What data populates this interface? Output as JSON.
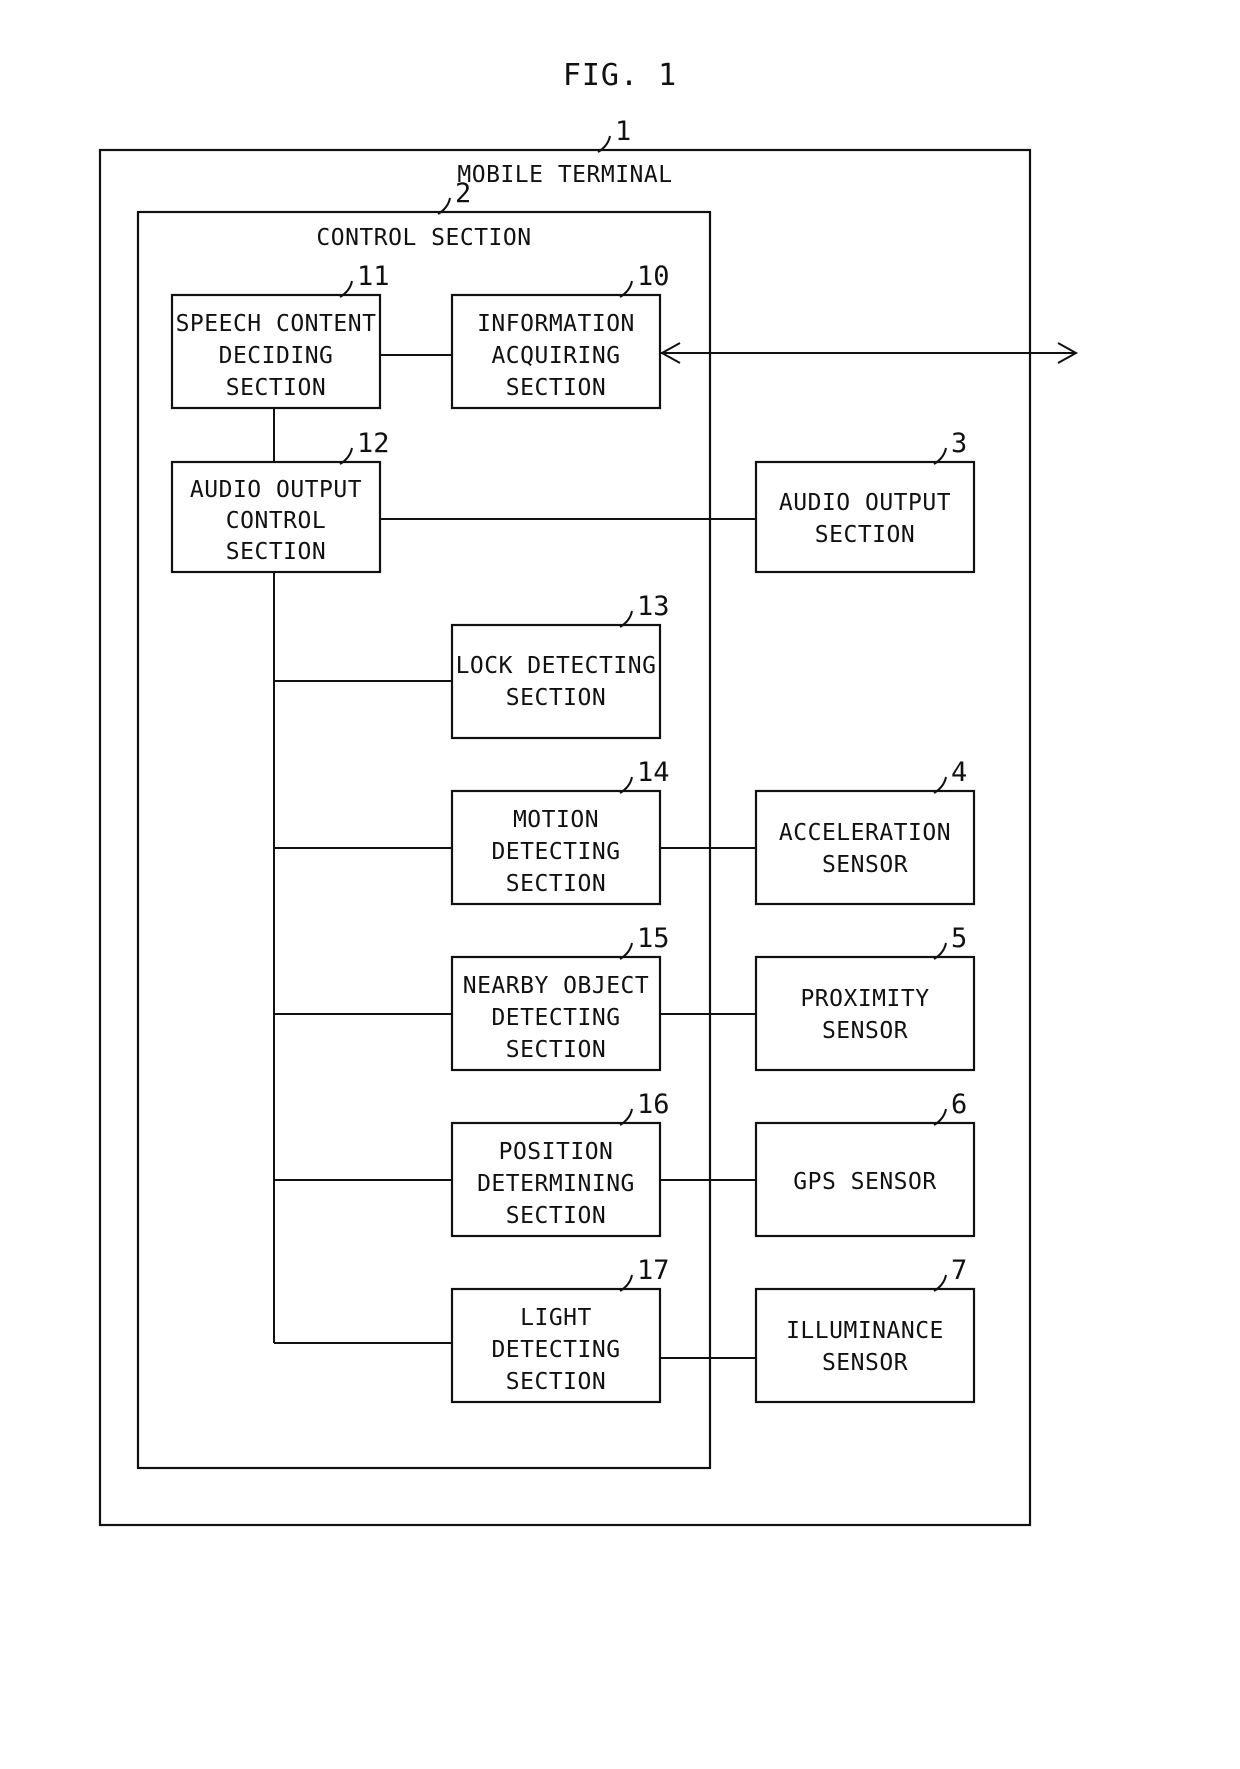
{
  "figure": {
    "title": "FIG. 1",
    "outer_frame": {
      "label": "MOBILE TERMINAL",
      "ref": "1"
    },
    "inner_frame": {
      "label": "CONTROL SECTION",
      "ref": "2"
    }
  },
  "blocks": {
    "speech_content": {
      "ref": "11",
      "line1": "SPEECH CONTENT",
      "line2": "DECIDING",
      "line3": "SECTION"
    },
    "information_acquiring": {
      "ref": "10",
      "line1": "INFORMATION",
      "line2": "ACQUIRING",
      "line3": "SECTION"
    },
    "audio_output_control": {
      "ref": "12",
      "line1": "AUDIO OUTPUT",
      "line2": "CONTROL",
      "line3": "SECTION"
    },
    "audio_output": {
      "ref": "3",
      "line1": "AUDIO OUTPUT",
      "line2": "SECTION",
      "line3": ""
    },
    "lock_detecting": {
      "ref": "13",
      "line1": "LOCK DETECTING",
      "line2": "SECTION",
      "line3": ""
    },
    "motion_detecting": {
      "ref": "14",
      "line1": "MOTION",
      "line2": "DETECTING",
      "line3": "SECTION"
    },
    "acceleration_sensor": {
      "ref": "4",
      "line1": "ACCELERATION",
      "line2": "SENSOR",
      "line3": ""
    },
    "nearby_object_detecting": {
      "ref": "15",
      "line1": "NEARBY OBJECT",
      "line2": "DETECTING",
      "line3": "SECTION"
    },
    "proximity_sensor": {
      "ref": "5",
      "line1": "PROXIMITY",
      "line2": "SENSOR",
      "line3": ""
    },
    "position_determining": {
      "ref": "16",
      "line1": "POSITION",
      "line2": "DETERMINING",
      "line3": "SECTION"
    },
    "gps_sensor": {
      "ref": "6",
      "line1": "GPS SENSOR",
      "line2": "",
      "line3": ""
    },
    "light_detecting": {
      "ref": "17",
      "line1": "LIGHT",
      "line2": "DETECTING",
      "line3": "SECTION"
    },
    "illuminance_sensor": {
      "ref": "7",
      "line1": "ILLUMINANCE",
      "line2": "SENSOR",
      "line3": ""
    }
  },
  "colors": {
    "ink": "#111111",
    "paper": "#ffffff"
  }
}
